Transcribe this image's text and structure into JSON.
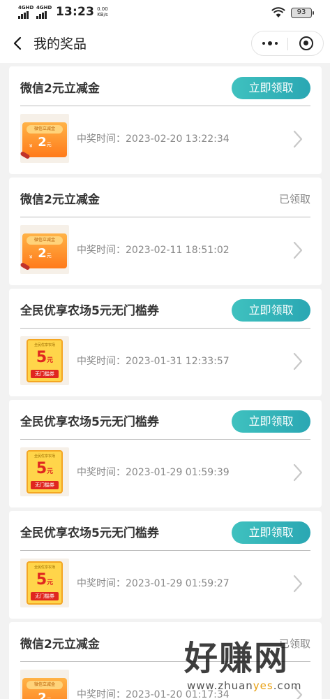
{
  "status_bar": {
    "network_1": "4GHD",
    "network_2": "4GHD",
    "time": "13:23",
    "net_speed_value": "0.00",
    "net_speed_unit": "KB/s",
    "battery": "93"
  },
  "nav": {
    "title": "我的奖品"
  },
  "labels": {
    "claim": "立即领取",
    "claimed": "已领取",
    "time_prefix": "中奖时间："
  },
  "wx_coupon_art": {
    "header": "微信立减金",
    "currency": "¥",
    "amount": "2",
    "unit": "元"
  },
  "farm_coupon_art": {
    "top": "全民优享农场",
    "amount": "5",
    "unit": "元",
    "label": "无门槛券"
  },
  "prizes": [
    {
      "title": "微信2元立减金",
      "status": "claim",
      "won_at": "2023-02-20 13:22:34",
      "art": "wx"
    },
    {
      "title": "微信2元立减金",
      "status": "claimed",
      "won_at": "2023-02-11 18:51:02",
      "art": "wx"
    },
    {
      "title": "全民优享农场5元无门槛券",
      "status": "claim",
      "won_at": "2023-01-31 12:33:57",
      "art": "farm"
    },
    {
      "title": "全民优享农场5元无门槛券",
      "status": "claim",
      "won_at": "2023-01-29 01:59:39",
      "art": "farm"
    },
    {
      "title": "全民优享农场5元无门槛券",
      "status": "claim",
      "won_at": "2023-01-29 01:59:27",
      "art": "farm"
    },
    {
      "title": "微信2元立减金",
      "status": "claimed",
      "won_at": "2023-01-20 01:17:34",
      "art": "wx"
    }
  ],
  "watermark": {
    "text": "好赚网",
    "url_part1": "www.zhuan",
    "url_highlight": "yes",
    "url_part2": ".com"
  },
  "colors": {
    "claim_button": "#2fb3b6",
    "page_bg": "#f2f2f2",
    "coupon_orange": "#ff8a1f",
    "coupon_red": "#e0261f"
  }
}
